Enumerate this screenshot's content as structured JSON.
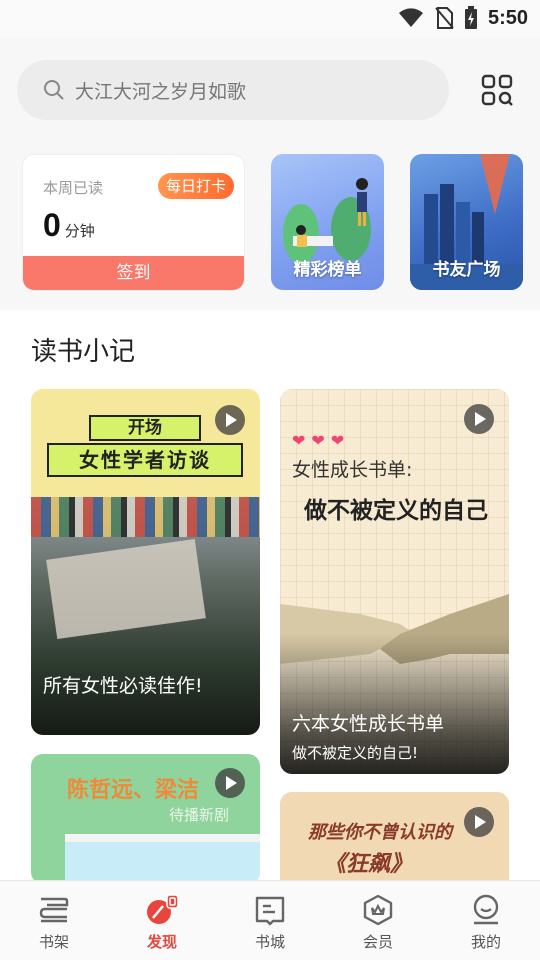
{
  "status_bar": {
    "time": "5:50"
  },
  "search": {
    "placeholder": "大江大河之岁月如歌"
  },
  "reading": {
    "label": "本周已读",
    "badge": "每日打卡",
    "minutes": "0",
    "unit": "分钟",
    "signin_label": "签到"
  },
  "tiles": [
    {
      "label": "精彩榜单"
    },
    {
      "label": "书友广场"
    }
  ],
  "section": {
    "title": "读书小记"
  },
  "cards": [
    {
      "banner_top": "开场",
      "banner_main": "女性学者访谈",
      "caption": "所有女性必读佳作!"
    },
    {
      "heading": "女性成长书单:",
      "headline": "做不被定义的自己",
      "caption": "六本女性成长书单",
      "subcaption": "做不被定义的自己!"
    },
    {
      "headline": "陈哲远、梁洁",
      "subheading": "待播新剧"
    },
    {
      "line1": "那些你不曾认识的",
      "line2": "《狂飙》"
    }
  ],
  "tabbar": {
    "items": [
      {
        "label": "书架",
        "icon": "bookshelf-icon",
        "active": false
      },
      {
        "label": "发现",
        "icon": "discover-icon",
        "active": true
      },
      {
        "label": "书城",
        "icon": "bookstore-icon",
        "active": false
      },
      {
        "label": "会员",
        "icon": "vip-icon",
        "active": false
      },
      {
        "label": "我的",
        "icon": "profile-icon",
        "active": false
      }
    ]
  },
  "colors": {
    "accent": "#e8463c",
    "signin": "#f9786a",
    "badge": "#ff7a3c"
  }
}
